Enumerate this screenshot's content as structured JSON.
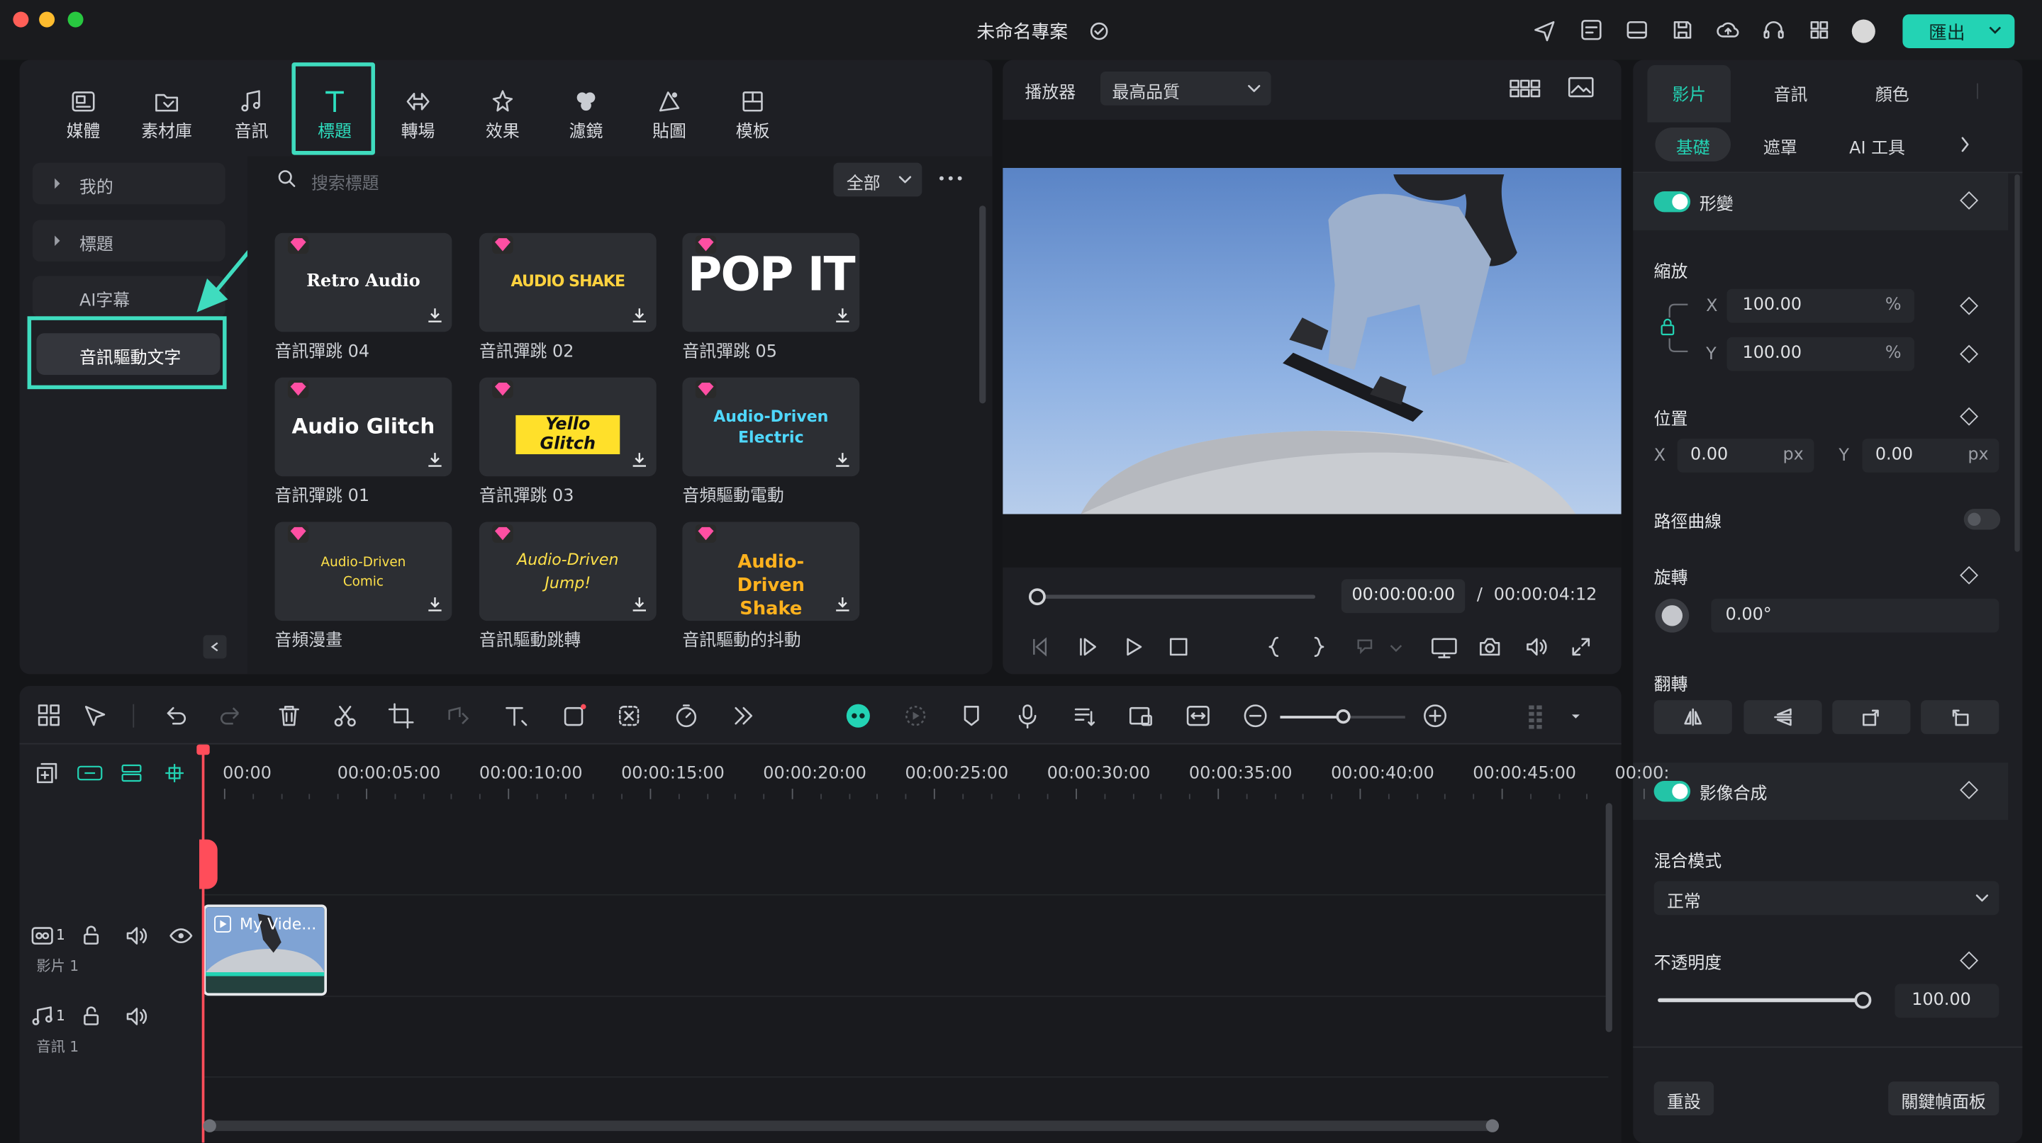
{
  "window": {
    "title": "未命名專案",
    "export_label": "匯出"
  },
  "library": {
    "tabs": [
      {
        "label": "媒體",
        "icon": "media-icon"
      },
      {
        "label": "素材庫",
        "icon": "stock-library-icon"
      },
      {
        "label": "音訊",
        "icon": "music-note-icon"
      },
      {
        "label": "標題",
        "icon": "text-t-icon"
      },
      {
        "label": "轉場",
        "icon": "transition-icon"
      },
      {
        "label": "效果",
        "icon": "effects-star-icon"
      },
      {
        "label": "濾鏡",
        "icon": "filters-icon"
      },
      {
        "label": "貼圖",
        "icon": "sticker-icon"
      },
      {
        "label": "模板",
        "icon": "template-icon"
      }
    ],
    "sidebar": {
      "mine": "我的",
      "titles": "標題",
      "ai_captions": "AI字幕",
      "audio_driven": "音訊驅動文字"
    },
    "search": {
      "placeholder": "搜索標題",
      "filter": "全部"
    },
    "items": [
      {
        "thumb": "Retro Audio",
        "label": "音訊彈跳 04"
      },
      {
        "thumb": "AUDIO SHAKE",
        "label": "音訊彈跳 02"
      },
      {
        "thumb": "POP IT",
        "label": "音訊彈跳 05"
      },
      {
        "thumb": "Audio Glitch",
        "label": "音訊彈跳 01"
      },
      {
        "thumb": "Yello Glitch",
        "label": "音訊彈跳 03"
      },
      {
        "thumb": "Audio-Driven Electric",
        "label": "音頻驅動電動"
      },
      {
        "thumb": "Audio-Driven Comic",
        "label": "音頻漫畫"
      },
      {
        "thumb": "Audio-Driven Jump!",
        "label": "音訊驅動跳轉"
      },
      {
        "thumb": "Audio-Driven Shake",
        "label": "音訊驅動的抖動"
      }
    ]
  },
  "player": {
    "label": "播放器",
    "quality": "最高品質",
    "current_time": "00:00:00:00",
    "separator": "/",
    "total_time": "00:00:04:12",
    "progress": 0
  },
  "properties": {
    "tabs": [
      "影片",
      "音訊",
      "顏色"
    ],
    "subtabs": [
      "基礎",
      "遮罩",
      "AI 工具"
    ],
    "transform": "形變",
    "scale": "縮放",
    "scale_x": {
      "axis": "X",
      "value": "100.00",
      "unit": "%"
    },
    "scale_y": {
      "axis": "Y",
      "value": "100.00",
      "unit": "%"
    },
    "position": "位置",
    "pos_x": {
      "axis": "X",
      "value": "0.00",
      "unit": "px"
    },
    "pos_y": {
      "axis": "Y",
      "value": "0.00",
      "unit": "px"
    },
    "path_curve": "路徑曲線",
    "rotate": "旋轉",
    "rotate_value": "0.00°",
    "flip": "翻轉",
    "compositing": "影像合成",
    "blend_mode": "混合模式",
    "blend_value": "正常",
    "opacity": "不透明度",
    "opacity_value": "100.00",
    "opacity_level": 1.0,
    "reset": "重設",
    "keyframe_panel": "關鍵幀面板"
  },
  "timeline": {
    "ruler": [
      "00:00",
      "00:00:05:00",
      "00:00:10:00",
      "00:00:15:00",
      "00:00:20:00",
      "00:00:25:00",
      "00:00:30:00",
      "00:00:35:00",
      "00:00:40:00",
      "00:00:45:00",
      "00:00:"
    ],
    "video_track": {
      "num": "1",
      "label": "影片 1"
    },
    "audio_track": {
      "num": "1",
      "label": "音訊 1"
    },
    "clip_label": "My Vide..."
  },
  "colors": {
    "accent": "#23d3b4",
    "highlight_box": "#3fdcbf",
    "playhead": "#ff4d5a"
  }
}
